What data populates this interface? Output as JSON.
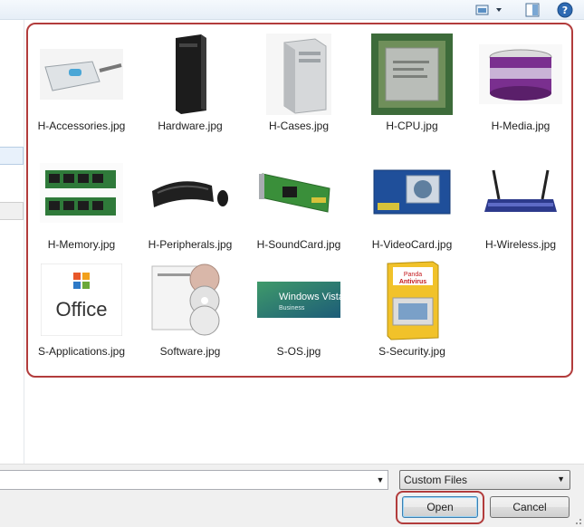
{
  "toolbar": {
    "views_icon": "views-icon",
    "preview_icon": "preview-pane-icon",
    "help_icon": "help-icon"
  },
  "files": [
    {
      "name": "H-Accessories.jpg",
      "icon": "usb-hub-thumbnail"
    },
    {
      "name": "Hardware.jpg",
      "icon": "tower-pc-thumbnail"
    },
    {
      "name": "H-Cases.jpg",
      "icon": "computer-case-thumbnail"
    },
    {
      "name": "H-CPU.jpg",
      "icon": "cpu-chip-thumbnail"
    },
    {
      "name": "H-Media.jpg",
      "icon": "dvd-spindle-thumbnail"
    },
    {
      "name": "H-Memory.jpg",
      "icon": "ram-modules-thumbnail"
    },
    {
      "name": "H-Peripherals.jpg",
      "icon": "keyboard-mouse-thumbnail"
    },
    {
      "name": "H-SoundCard.jpg",
      "icon": "sound-card-thumbnail"
    },
    {
      "name": "H-VideoCard.jpg",
      "icon": "video-card-thumbnail"
    },
    {
      "name": "H-Wireless.jpg",
      "icon": "wireless-router-thumbnail"
    },
    {
      "name": "S-Applications.jpg",
      "icon": "office-logo-thumbnail",
      "logo_text": "Office"
    },
    {
      "name": "Software.jpg",
      "icon": "software-discs-thumbnail"
    },
    {
      "name": "S-OS.jpg",
      "icon": "windows-vista-thumbnail",
      "logo_text": "Windows Vista",
      "logo_sub": "Business"
    },
    {
      "name": "S-Security.jpg",
      "icon": "antivirus-box-thumbnail",
      "logo_text": "Panda",
      "logo_sub": "Antivirus"
    }
  ],
  "bottom": {
    "filename_value": "",
    "filter_value": "Custom Files",
    "open_label": "Open",
    "cancel_label": "Cancel"
  },
  "colors": {
    "highlight": "#b23c3c",
    "default_button_border": "#3c7fb1"
  }
}
